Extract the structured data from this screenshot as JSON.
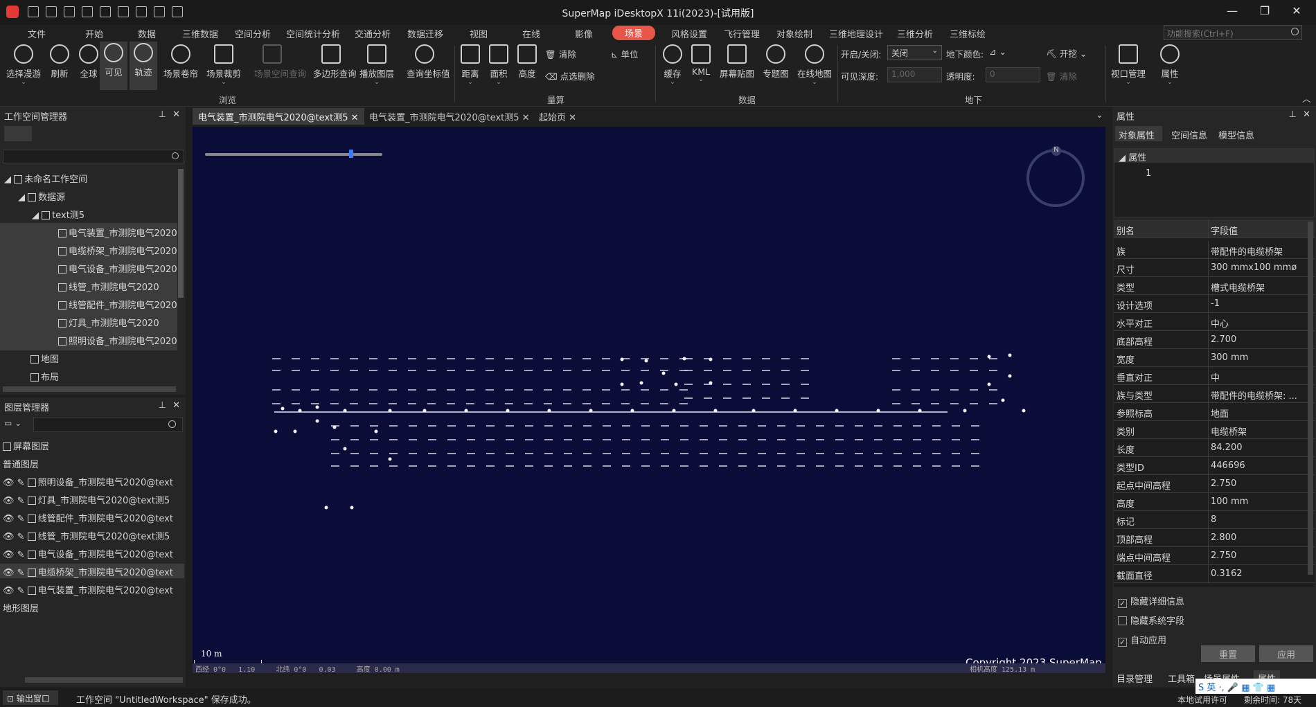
{
  "window": {
    "title": "SuperMap iDesktopX 11i(2023)-[试用版]"
  },
  "menu": {
    "tabs": [
      "文件",
      "开始",
      "数据",
      "三维数据",
      "空间分析",
      "空间统计分析",
      "交通分析",
      "数据迁移",
      "视图",
      "在线",
      "影像",
      "场景",
      "风格设置",
      "飞行管理",
      "对象绘制",
      "三维地理设计",
      "三维分析",
      "三维标绘"
    ],
    "active": "场景",
    "search_placeholder": "功能搜索(Ctrl+F)"
  },
  "ribbon": {
    "browse": {
      "buttons": [
        "选择漫游",
        "刷新",
        "全球",
        "可见",
        "轨迹",
        "场景卷帘",
        "场景裁剪",
        "场景空间查询",
        "多边形查询",
        "播放图层",
        "查询坐标值"
      ],
      "group": "浏览"
    },
    "measure": {
      "buttons": [
        "距离",
        "面积",
        "高度"
      ],
      "small": [
        "清除",
        "点选删除",
        "单位"
      ],
      "group": "量算"
    },
    "data": {
      "buttons": [
        "缓存",
        "KML",
        "屏幕贴图",
        "专题图",
        "在线地图"
      ],
      "group": "数据"
    },
    "underground": {
      "toggle_label": "开启/关闭:",
      "toggle_value": "关闭",
      "color_label": "地下颜色:",
      "depth_label": "可见深度:",
      "depth_value": "1,000",
      "opacity_label": "透明度:",
      "opacity_value": "0",
      "excavate": "开挖",
      "clear": "清除",
      "group": "地下"
    },
    "view": {
      "buttons": [
        "视口管理",
        "属性"
      ]
    }
  },
  "workspace": {
    "title": "工作空间管理器",
    "items": [
      "未命名工作空间",
      "数据源",
      "text测5",
      "电气装置_市测院电气2020",
      "电缆桥架_市测院电气2020",
      "电气设备_市测院电气2020",
      "线管_市测院电气2020",
      "线管配件_市测院电气2020",
      "灯具_市测院电气2020",
      "照明设备_市测院电气2020",
      "地图",
      "布局"
    ]
  },
  "layers": {
    "title": "图层管理器",
    "screen_layer": "屏幕图层",
    "normal_layers": "普通图层",
    "items": [
      "照明设备_市测院电气2020@text",
      "灯具_市测院电气2020@text测5",
      "线管配件_市测院电气2020@text",
      "线管_市测院电气2020@text测5",
      "电气设备_市测院电气2020@text",
      "电缆桥架_市测院电气2020@text",
      "电气装置_市测院电气2020@text"
    ],
    "terrain_layers": "地形图层"
  },
  "doc_tabs": [
    "电气装置_市测院电气2020@text测5",
    "电气装置_市测院电气2020@text测5",
    "起始页"
  ],
  "scene": {
    "scale": "10 m",
    "copyright": "Copyright 2023 SuperMap",
    "status_left": "西经 0°0   1.10     北纬 0°0   0.03     高度 0.00 m",
    "status_right": "相机高度 125.13 m",
    "compass": "N"
  },
  "properties": {
    "title": "属性",
    "tabs": [
      "对象属性",
      "空间信息",
      "模型信息"
    ],
    "section": "属性",
    "section_value": "1",
    "columns": [
      "别名",
      "字段值"
    ],
    "rows": [
      [
        "族",
        "带配件的电缆桥架"
      ],
      [
        "尺寸",
        "300 mmx100 mmø"
      ],
      [
        "类型",
        "槽式电缆桥架"
      ],
      [
        "设计选项",
        "-1"
      ],
      [
        "水平对正",
        "中心"
      ],
      [
        "底部高程",
        "2.700"
      ],
      [
        "宽度",
        "300 mm"
      ],
      [
        "垂直对正",
        "中"
      ],
      [
        "族与类型",
        "带配件的电缆桥架: ..."
      ],
      [
        "参照标高",
        "地面"
      ],
      [
        "类别",
        "电缆桥架"
      ],
      [
        "长度",
        "84.200"
      ],
      [
        "类型ID",
        "446696"
      ],
      [
        "起点中间高程",
        "2.750"
      ],
      [
        "高度",
        "100 mm"
      ],
      [
        "标记",
        "8"
      ],
      [
        "顶部高程",
        "2.800"
      ],
      [
        "端点中间高程",
        "2.750"
      ],
      [
        "截面直径",
        "0.3162"
      ]
    ],
    "checks": [
      [
        "隐藏详细信息",
        true
      ],
      [
        "隐藏系统字段",
        false
      ],
      [
        "自动应用",
        true
      ]
    ],
    "reset": "重置",
    "apply": "应用",
    "bottom_tabs": [
      "目录管理",
      "工具箱",
      "场景属性",
      "属性"
    ]
  },
  "statusbar": {
    "output": "输出窗口",
    "message": "工作空间 \"UntitledWorkspace\" 保存成功。",
    "license": "本地试用许可",
    "days": "剩余时间: 78天"
  }
}
